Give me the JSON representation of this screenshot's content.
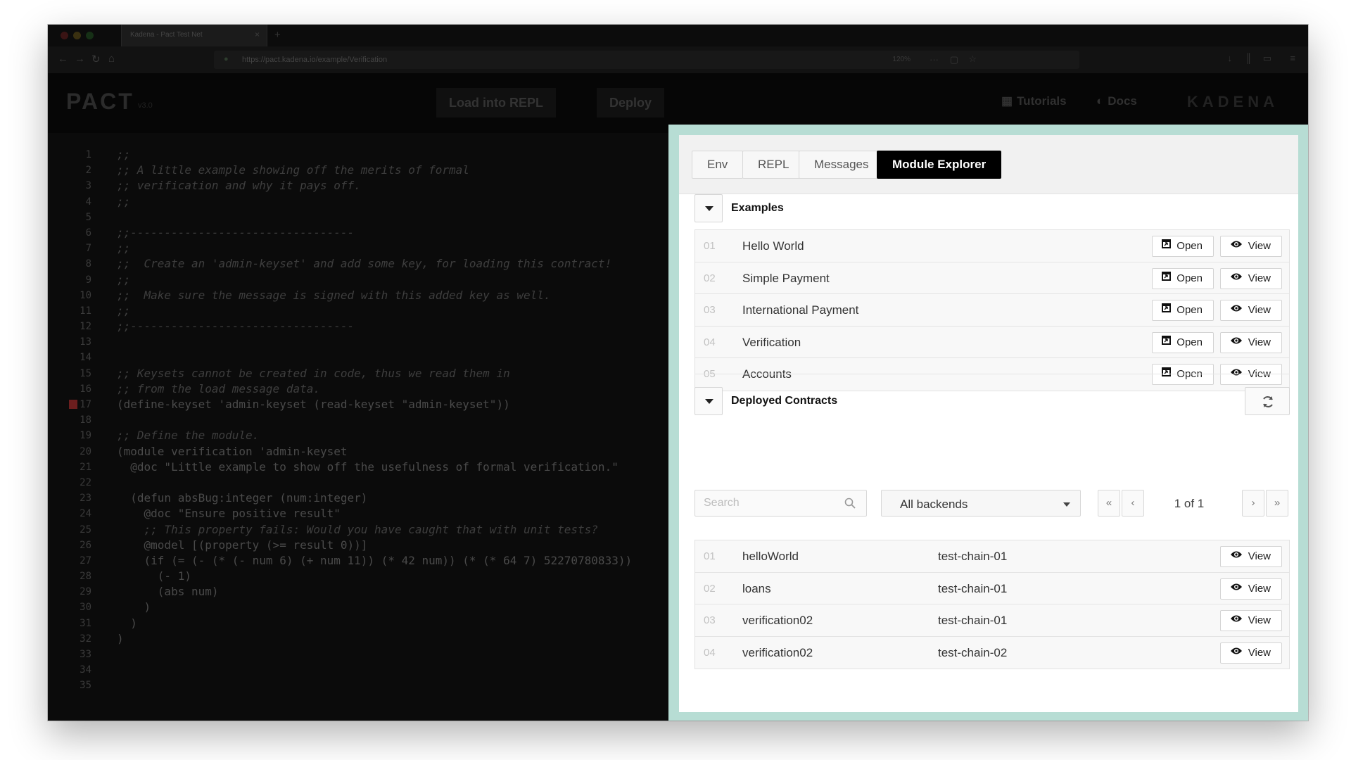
{
  "browser": {
    "tab_title": "Kadena - Pact Test Net",
    "url": "https://pact.kadena.io/example/Verification",
    "zoom": "120%"
  },
  "app_header": {
    "logo": "PACT",
    "logo_sub": "v3.0",
    "load_repl_label": "Load into REPL",
    "deploy_label": "Deploy",
    "tutorials_label": "Tutorials",
    "docs_label": "Docs",
    "brand": "KADENA"
  },
  "editor": {
    "lines": [
      {
        "n": "1",
        "text": ";;",
        "cmt": true
      },
      {
        "n": "2",
        "text": ";; A little example showing off the merits of formal",
        "cmt": true
      },
      {
        "n": "3",
        "text": ";; verification and why it pays off.",
        "cmt": true
      },
      {
        "n": "4",
        "text": ";;",
        "cmt": true
      },
      {
        "n": "5",
        "text": "",
        "cmt": false
      },
      {
        "n": "6",
        "text": ";;---------------------------------",
        "cmt": true
      },
      {
        "n": "7",
        "text": ";;",
        "cmt": true
      },
      {
        "n": "8",
        "text": ";;  Create an 'admin-keyset' and add some key, for loading this contract!",
        "cmt": true
      },
      {
        "n": "9",
        "text": ";;",
        "cmt": true
      },
      {
        "n": "10",
        "text": ";;  Make sure the message is signed with this added key as well.",
        "cmt": true
      },
      {
        "n": "11",
        "text": ";;",
        "cmt": true
      },
      {
        "n": "12",
        "text": ";;---------------------------------",
        "cmt": true
      },
      {
        "n": "13",
        "text": "",
        "cmt": false
      },
      {
        "n": "14",
        "text": "",
        "cmt": false
      },
      {
        "n": "15",
        "text": ";; Keysets cannot be created in code, thus we read them in",
        "cmt": true
      },
      {
        "n": "16",
        "text": ";; from the load message data.",
        "cmt": true
      },
      {
        "n": "17",
        "text": "(define-keyset 'admin-keyset (read-keyset \"admin-keyset\"))",
        "cmt": false
      },
      {
        "n": "18",
        "text": "",
        "cmt": false
      },
      {
        "n": "19",
        "text": ";; Define the module.",
        "cmt": true
      },
      {
        "n": "20",
        "text": "(module verification 'admin-keyset",
        "cmt": false
      },
      {
        "n": "21",
        "text": "  @doc \"Little example to show off the usefulness of formal verification.\"",
        "cmt": false
      },
      {
        "n": "22",
        "text": "",
        "cmt": false
      },
      {
        "n": "23",
        "text": "  (defun absBug:integer (num:integer)",
        "cmt": false
      },
      {
        "n": "24",
        "text": "    @doc \"Ensure positive result\"",
        "cmt": false
      },
      {
        "n": "25",
        "text": "    ;; This property fails: Would you have caught that with unit tests?",
        "cmt": true
      },
      {
        "n": "26",
        "text": "    @model [(property (>= result 0))]",
        "cmt": false
      },
      {
        "n": "27",
        "text": "    (if (= (- (* (- num 6) (+ num 11)) (* 42 num)) (* (* 64 7) 52270780833))",
        "cmt": false
      },
      {
        "n": "28",
        "text": "      (- 1)",
        "cmt": false
      },
      {
        "n": "29",
        "text": "      (abs num)",
        "cmt": false
      },
      {
        "n": "30",
        "text": "    )",
        "cmt": false
      },
      {
        "n": "31",
        "text": "  )",
        "cmt": false
      },
      {
        "n": "32",
        "text": ")",
        "cmt": false
      },
      {
        "n": "33",
        "text": "",
        "cmt": false
      },
      {
        "n": "34",
        "text": "",
        "cmt": false
      },
      {
        "n": "35",
        "text": "",
        "cmt": false
      }
    ]
  },
  "panel": {
    "tabs": [
      "Env",
      "REPL",
      "Messages",
      "Module Explorer"
    ],
    "active_tab": "Module Explorer",
    "examples": {
      "title": "Examples",
      "open_label": "Open",
      "view_label": "View",
      "items": [
        {
          "num": "01",
          "name": "Hello World"
        },
        {
          "num": "02",
          "name": "Simple Payment"
        },
        {
          "num": "03",
          "name": "International Payment"
        },
        {
          "num": "04",
          "name": "Verification"
        },
        {
          "num": "05",
          "name": "Accounts"
        }
      ]
    },
    "deployed": {
      "title": "Deployed Contracts",
      "search_placeholder": "Search",
      "backend_selected": "All backends",
      "page_text": "1 of 1",
      "view_label": "View",
      "items": [
        {
          "num": "01",
          "name": "helloWorld",
          "chain": "test-chain-01"
        },
        {
          "num": "02",
          "name": "loans",
          "chain": "test-chain-01"
        },
        {
          "num": "03",
          "name": "verification02",
          "chain": "test-chain-01"
        },
        {
          "num": "04",
          "name": "verification02",
          "chain": "test-chain-02"
        }
      ]
    }
  },
  "colors": {
    "panel_frame": "#b7ddd4",
    "active_tab_bg": "#000000",
    "overlay_bg": "#000000"
  }
}
